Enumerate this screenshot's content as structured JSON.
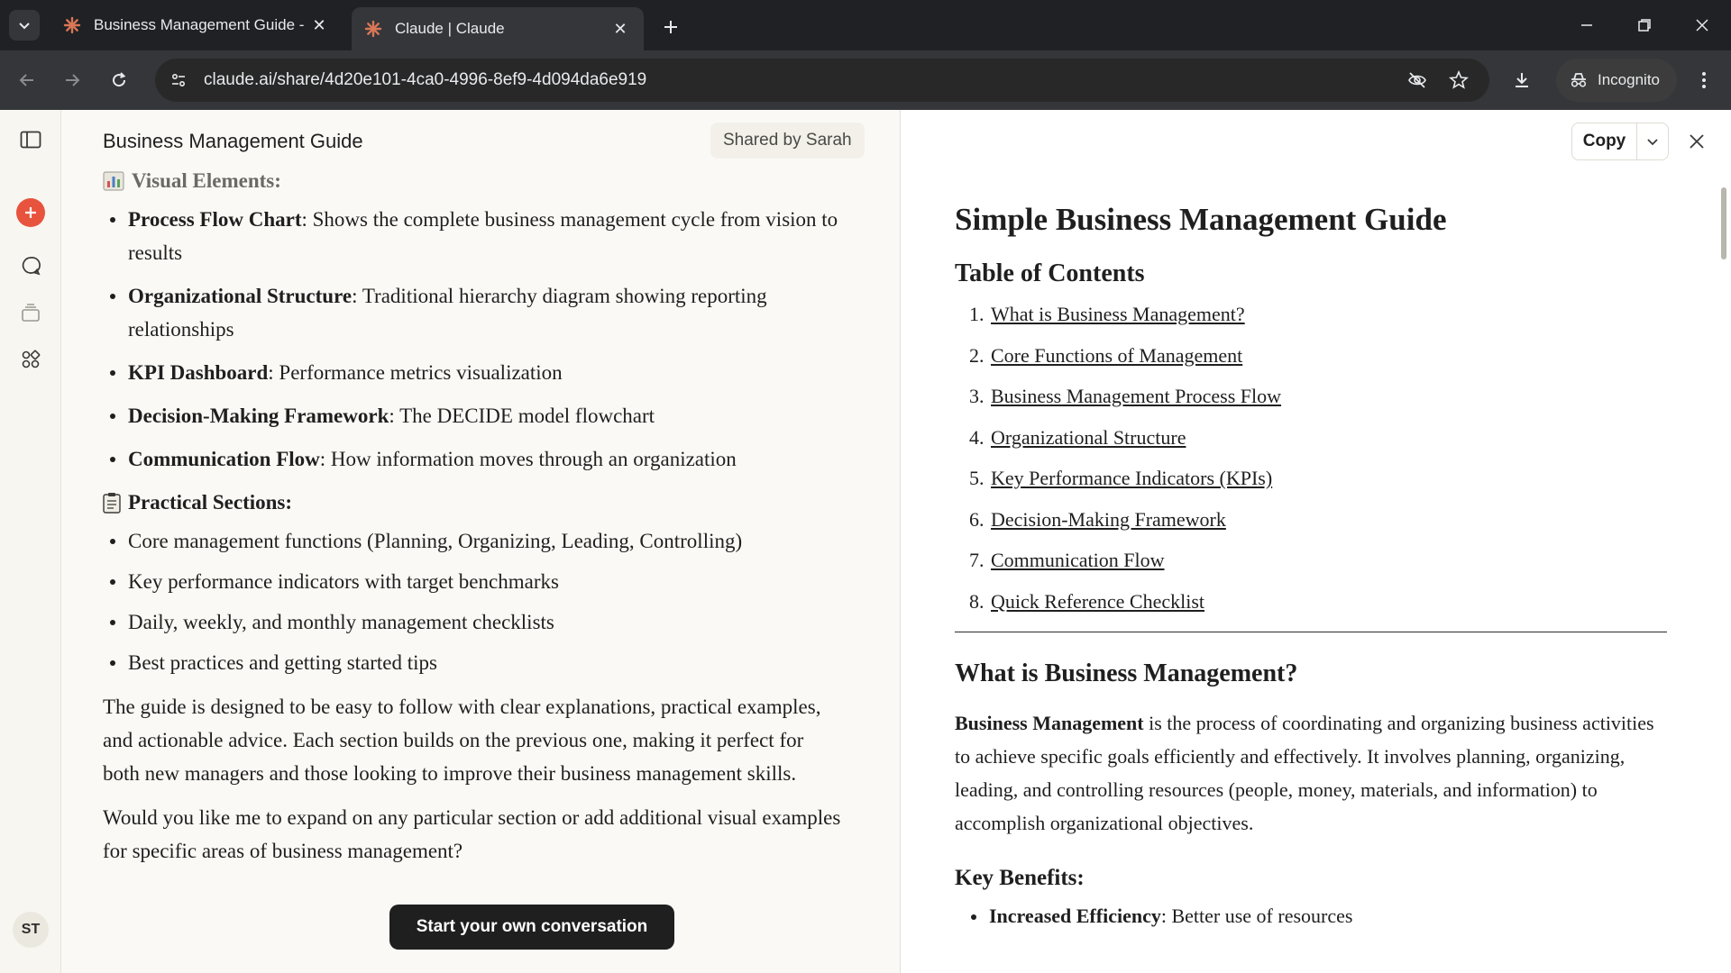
{
  "browser": {
    "tabs": [
      {
        "title": "Business Management Guide -",
        "active": false
      },
      {
        "title": "Claude | Claude",
        "active": true
      }
    ],
    "url": "claude.ai/share/4d20e101-4ca0-4996-8ef9-4d094da6e919",
    "incognito_label": "Incognito"
  },
  "chat": {
    "title": "Business Management Guide",
    "shared_by": "Shared by Sarah",
    "visual_heading": "Visual Elements:",
    "visual_items": [
      {
        "bold": "Process Flow Chart",
        "text": ": Shows the complete business management cycle from vision to results"
      },
      {
        "bold": "Organizational Structure",
        "text": ": Traditional hierarchy diagram showing reporting relationships"
      },
      {
        "bold": "KPI Dashboard",
        "text": ": Performance metrics visualization"
      },
      {
        "bold": "Decision-Making Framework",
        "text": ": The DECIDE model flowchart"
      },
      {
        "bold": "Communication Flow",
        "text": ": How information moves through an organization"
      }
    ],
    "practical_heading": "Practical Sections:",
    "practical_items": [
      "Core management functions (Planning, Organizing, Leading, Controlling)",
      "Key performance indicators with target benchmarks",
      "Daily, weekly, and monthly management checklists",
      "Best practices and getting started tips"
    ],
    "paragraph": "The guide is designed to be easy to follow with clear explanations, practical examples, and actionable advice. Each section builds on the previous one, making it perfect for both new managers and those looking to improve their business management skills.",
    "closing_question": "Would you like me to expand on any particular section or add additional visual examples for specific areas of business management?",
    "cta_label": "Start your own conversation",
    "avatar_initials": "ST"
  },
  "artifact": {
    "copy_label": "Copy",
    "title": "Simple Business Management Guide",
    "toc_heading": "Table of Contents",
    "toc": [
      "What is Business Management?",
      "Core Functions of Management",
      "Business Management Process Flow",
      "Organizational Structure",
      "Key Performance Indicators (KPIs)",
      "Decision-Making Framework",
      "Communication Flow",
      "Quick Reference Checklist"
    ],
    "section_heading": "What is Business Management?",
    "intro_bold": "Business Management",
    "intro_text": " is the process of coordinating and organizing business activities to achieve specific goals efficiently and effectively. It involves planning, organizing, leading, and controlling resources (people, money, materials, and information) to accomplish organizational objectives.",
    "benefits_heading": "Key Benefits:",
    "benefits": [
      {
        "bold": "Increased Efficiency",
        "text": ": Better use of resources"
      }
    ]
  },
  "colors": {
    "accent": "#e8533d",
    "chrome_dark": "#202124",
    "chrome_mid": "#35363a",
    "page_bg": "#faf9f5"
  }
}
